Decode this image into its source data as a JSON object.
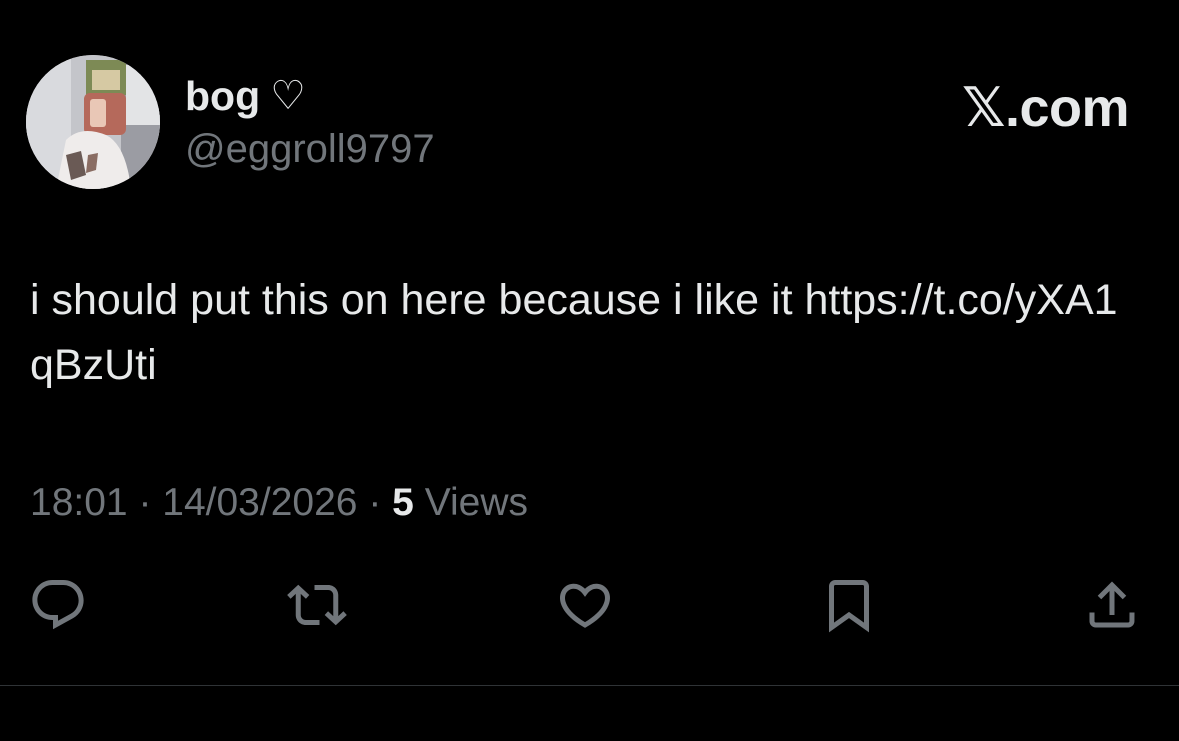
{
  "author": {
    "display_name": "bog",
    "name_emoji": "♡",
    "handle": "@eggroll9797"
  },
  "brand": {
    "label": "𝕏.com"
  },
  "tweet": {
    "text": "i should put this on here because i like it https://t.co/yXA1qBzUti"
  },
  "meta": {
    "time": "18:01",
    "sep1": " · ",
    "date": "14/03/2026",
    "sep2": " · ",
    "views_count": "5",
    "views_label": " Views"
  },
  "actions": [
    {
      "name": "reply",
      "icon": "speech-bubble-icon"
    },
    {
      "name": "repost",
      "icon": "repost-icon"
    },
    {
      "name": "like",
      "icon": "heart-icon"
    },
    {
      "name": "bookmark",
      "icon": "bookmark-icon"
    },
    {
      "name": "share",
      "icon": "share-icon"
    }
  ],
  "colors": {
    "background": "#000000",
    "primary_text": "#e7e9ea",
    "secondary_text": "#71767b",
    "divider": "#2f3336"
  }
}
